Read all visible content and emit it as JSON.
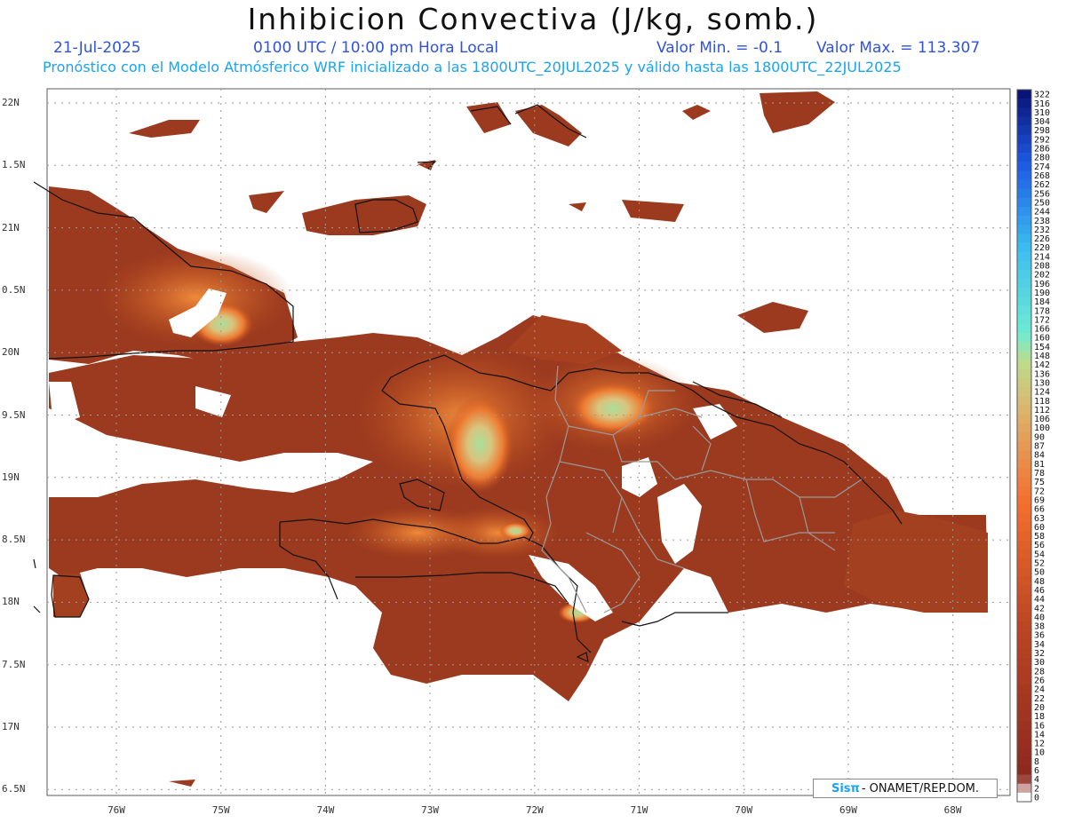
{
  "header": {
    "title": "Inhibicion Convectiva (J/kg, somb.)",
    "date": "21-Jul-2025",
    "time": "0100 UTC / 10:00 pm Hora Local",
    "min_label": "Valor Min. = -0.1",
    "max_label": "Valor Max. = 113.307",
    "model_line": "Pronóstico con el Modelo Atmósferico WRF inicializado a las 1800UTC_20JUL2025 y válido hasta las  1800UTC_22JUL2025"
  },
  "axes": {
    "lat_labels": [
      "22N",
      "1.5N",
      "21N",
      "0.5N",
      "20N",
      "9.5N",
      "19N",
      "8.5N",
      "18N",
      "7.5N",
      "17N",
      "6.5N"
    ],
    "lon_labels": [
      "76W",
      "75W",
      "74W",
      "73W",
      "72W",
      "71W",
      "70W",
      "69W",
      "68W"
    ]
  },
  "legend": {
    "labels": [
      "322",
      "316",
      "310",
      "304",
      "298",
      "292",
      "286",
      "280",
      "274",
      "268",
      "262",
      "256",
      "250",
      "244",
      "238",
      "232",
      "226",
      "220",
      "214",
      "208",
      "202",
      "196",
      "190",
      "184",
      "178",
      "172",
      "166",
      "160",
      "154",
      "148",
      "142",
      "136",
      "130",
      "124",
      "118",
      "112",
      "106",
      "100",
      "90",
      "87",
      "84",
      "81",
      "78",
      "75",
      "72",
      "69",
      "66",
      "63",
      "60",
      "58",
      "56",
      "54",
      "52",
      "50",
      "48",
      "46",
      "44",
      "42",
      "40",
      "38",
      "36",
      "34",
      "32",
      "30",
      "28",
      "26",
      "24",
      "22",
      "20",
      "18",
      "16",
      "14",
      "12",
      "10",
      "8",
      "6",
      "4",
      "2",
      "0"
    ]
  },
  "credit": {
    "logo": "Sisπ",
    "org": "- ONAMET/REP.DOM."
  },
  "colors": {
    "field_base": "#9b3a1f",
    "field_mid": "#c4511f",
    "field_high": "#ee7a30",
    "field_peak": "#a8e09a",
    "coast": "#111111",
    "borders": "#9a9a9a"
  }
}
